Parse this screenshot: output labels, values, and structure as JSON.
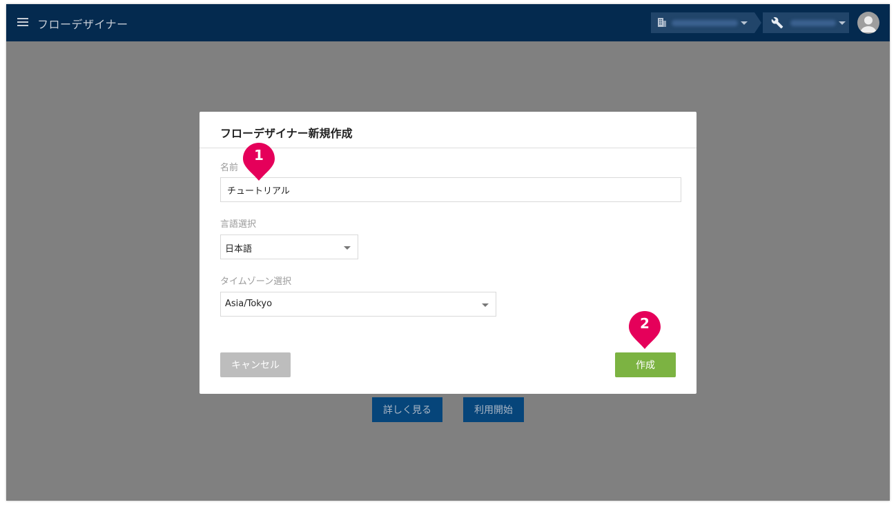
{
  "header": {
    "app_title": "フローデザイナー",
    "menu_icon": "hamburger-icon",
    "org_icon": "building-icon",
    "tool_icon": "wrench-icon",
    "avatar_icon": "user-avatar-icon"
  },
  "background": {
    "details_label": "詳しく見る",
    "start_label": "利用開始"
  },
  "dialog": {
    "title": "フローデザイナー新規作成",
    "name_label": "名前",
    "name_value": "チュートリアル",
    "language_label": "言語選択",
    "language_value": "日本語",
    "timezone_label": "タイムゾーン選択",
    "timezone_value": "Asia/Tokyo",
    "cancel_label": "キャンセル",
    "create_label": "作成"
  },
  "callouts": [
    "1",
    "2"
  ],
  "colors": {
    "header_bg": "#042a4f",
    "overlay": "#808080",
    "create_button": "#7cb342",
    "cancel_button": "#bdbdbd",
    "callout_pin": "#e5005a",
    "background_button": "#06457a"
  }
}
